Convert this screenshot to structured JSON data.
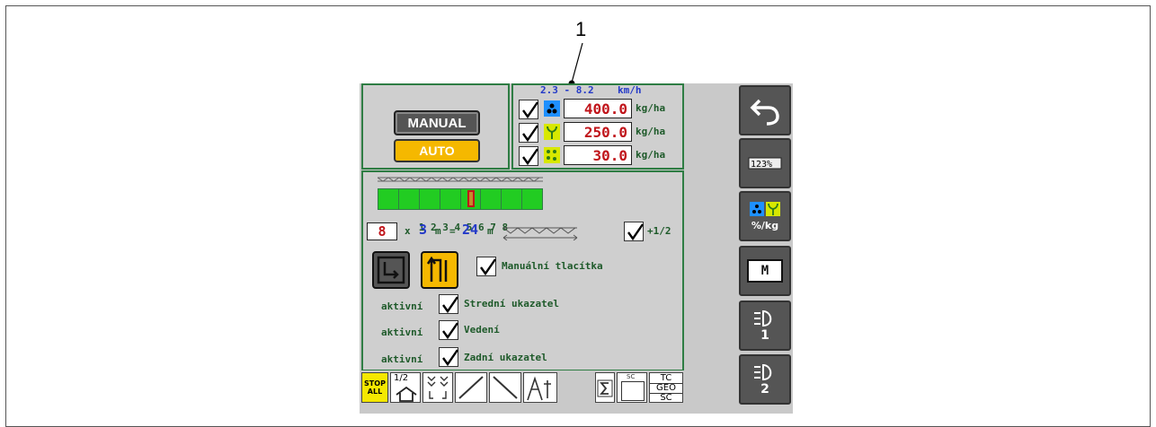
{
  "callout": {
    "number": "1"
  },
  "mode": {
    "manual_label": "MANUAL",
    "auto_label": "AUTO"
  },
  "rates": {
    "speed_range": "2.3 - 8.2",
    "speed_unit": "km/h",
    "items": [
      {
        "value": "400.0",
        "unit": "kg/ha",
        "icon": "fertilizer-icon",
        "color": "#1e90ff"
      },
      {
        "value": "250.0",
        "unit": "kg/ha",
        "icon": "seed-sprout-icon",
        "color": "#d8e800"
      },
      {
        "value": "30.0",
        "unit": "kg/ha",
        "icon": "microgranule-icon",
        "color": "#d8e800"
      }
    ]
  },
  "sections": {
    "numbers": [
      "1",
      "2",
      "3",
      "4",
      "5",
      "6",
      "7",
      "8"
    ],
    "count": "8",
    "times": "x",
    "width": "3",
    "unit": "m",
    "equals": "=",
    "total": "24",
    "total_unit": "m",
    "half_label": "+1/2",
    "active_color": "#22cc22"
  },
  "options": {
    "manual_buttons_label": "Manuální tlacítka",
    "active_word": "aktivní",
    "rows": [
      "Strední ukazatel",
      "Vedení",
      "Zadní ukazatel"
    ]
  },
  "bottom_bar": {
    "stop_line1": "STOP",
    "stop_line2": "ALL",
    "half_label": "1/2",
    "sc_label": "SC",
    "tc_label": "TC",
    "geo_label": "GEO",
    "sc2_label": "SC"
  },
  "right_bar": {
    "units_label": "%/kg",
    "light1_num": "1",
    "light2_num": "2",
    "m_label": "M"
  }
}
